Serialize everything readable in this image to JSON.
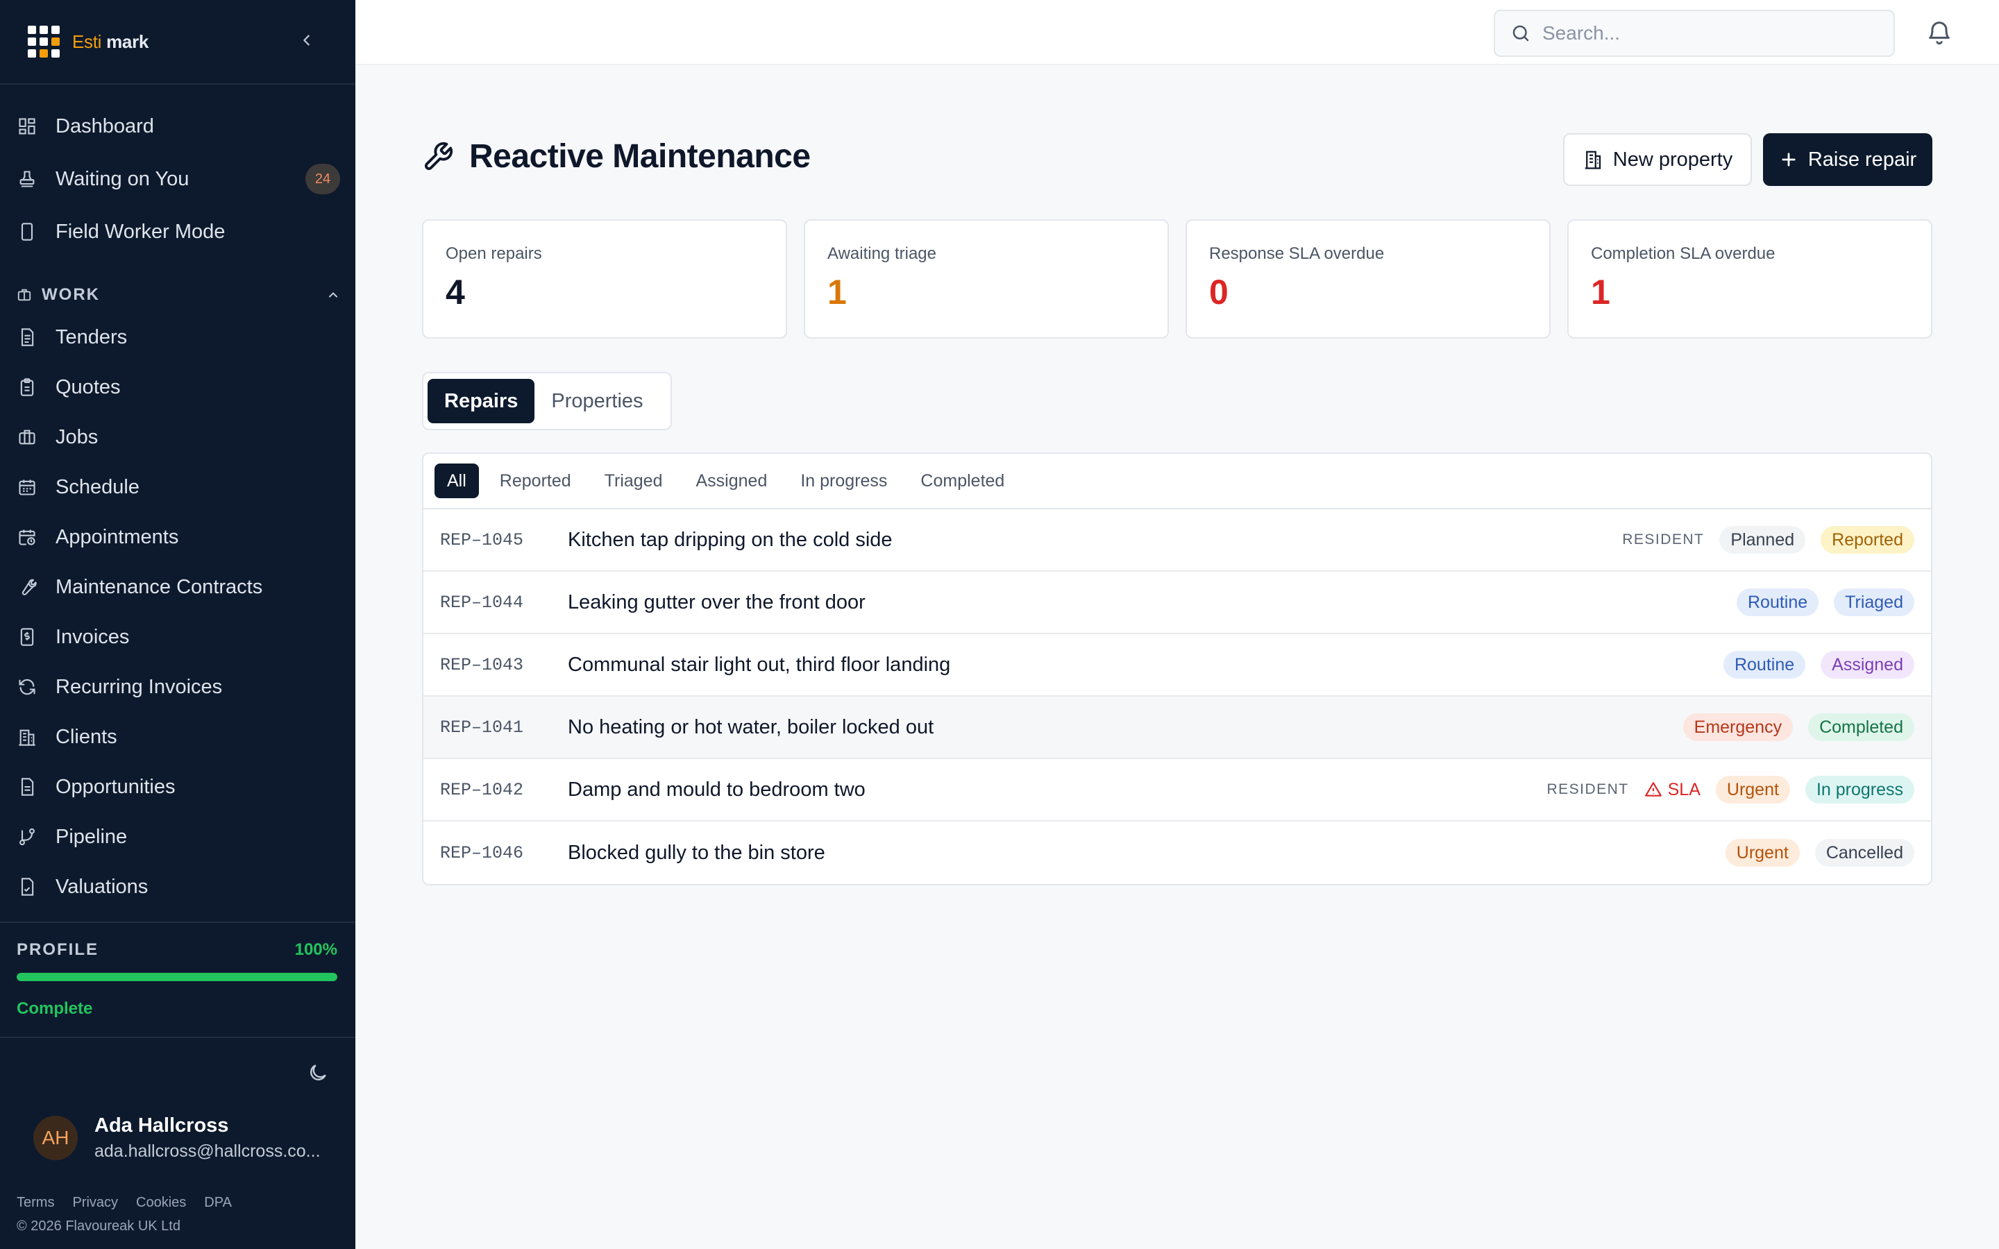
{
  "app": {
    "brand_a": "Esti",
    "brand_b": "mark"
  },
  "sidebar": {
    "items": [
      {
        "label": "Dashboard"
      },
      {
        "label": "Waiting on You",
        "badge": "24"
      },
      {
        "label": "Field Worker Mode"
      }
    ],
    "section": "WORK",
    "work_items": [
      {
        "label": "Tenders"
      },
      {
        "label": "Quotes"
      },
      {
        "label": "Jobs"
      },
      {
        "label": "Schedule"
      },
      {
        "label": "Appointments"
      },
      {
        "label": "Maintenance Contracts"
      },
      {
        "label": "Invoices"
      },
      {
        "label": "Recurring Invoices"
      },
      {
        "label": "Clients"
      },
      {
        "label": "Opportunities"
      },
      {
        "label": "Pipeline"
      },
      {
        "label": "Valuations"
      }
    ],
    "profile": {
      "title": "PROFILE",
      "percent_label": "100%",
      "progress": 1.0,
      "status": "Complete"
    },
    "user": {
      "initials": "AH",
      "name": "Ada Hallcross",
      "email": "ada.hallcross@hallcross.co..."
    },
    "legal": [
      "Terms",
      "Privacy",
      "Cookies",
      "DPA"
    ],
    "copyright": "© 2026 Flavoureak UK Ltd"
  },
  "header": {
    "search_placeholder": "Search..."
  },
  "page": {
    "title": "Reactive Maintenance",
    "new_property": "New property",
    "raise_repair": "Raise repair"
  },
  "stats": [
    {
      "label": "Open repairs",
      "value": "4",
      "color": "#0f172a"
    },
    {
      "label": "Awaiting triage",
      "value": "1",
      "color": "#d97706"
    },
    {
      "label": "Response SLA overdue",
      "value": "0",
      "color": "#dc2626"
    },
    {
      "label": "Completion SLA overdue",
      "value": "1",
      "color": "#dc2626"
    }
  ],
  "tabs": [
    "Repairs",
    "Properties"
  ],
  "filters": [
    "All",
    "Reported",
    "Triaged",
    "Assigned",
    "In progress",
    "Completed"
  ],
  "repairs": [
    {
      "id": "REP–1045",
      "title": "Kitchen tap dripping on the cold side",
      "source": "RESIDENT",
      "sla": "",
      "priority": "Planned",
      "status": "Reported"
    },
    {
      "id": "REP–1044",
      "title": "Leaking gutter over the front door",
      "source": "",
      "sla": "",
      "priority": "Routine",
      "status": "Triaged"
    },
    {
      "id": "REP–1043",
      "title": "Communal stair light out, third floor landing",
      "source": "",
      "sla": "",
      "priority": "Routine",
      "status": "Assigned"
    },
    {
      "id": "REP–1041",
      "title": "No heating or hot water, boiler locked out",
      "source": "",
      "sla": "",
      "priority": "Emergency",
      "status": "Completed"
    },
    {
      "id": "REP–1042",
      "title": "Damp and mould to bedroom two",
      "source": "RESIDENT",
      "sla": "SLA",
      "priority": "Urgent",
      "status": "In progress"
    },
    {
      "id": "REP–1046",
      "title": "Blocked gully to the bin store",
      "source": "",
      "sla": "",
      "priority": "Urgent",
      "status": "Cancelled"
    }
  ],
  "pill_colors": {
    "Planned": {
      "bg": "#f1f3f5",
      "fg": "#374151"
    },
    "Routine": {
      "bg": "#e3ecfb",
      "fg": "#2f5bb5"
    },
    "Emergency": {
      "bg": "#fde6df",
      "fg": "#b4361b"
    },
    "Urgent": {
      "bg": "#fdebdc",
      "fg": "#b45309"
    },
    "Reported": {
      "bg": "#fdf3c7",
      "fg": "#a16207"
    },
    "Triaged": {
      "bg": "#e3ecfb",
      "fg": "#2f5bb5"
    },
    "Assigned": {
      "bg": "#f1e6fb",
      "fg": "#7b3fb3"
    },
    "Completed": {
      "bg": "#dff5ea",
      "fg": "#157347"
    },
    "In progress": {
      "bg": "#dcf5f3",
      "fg": "#0f766e"
    },
    "Cancelled": {
      "bg": "#f1f3f5",
      "fg": "#374151"
    }
  }
}
